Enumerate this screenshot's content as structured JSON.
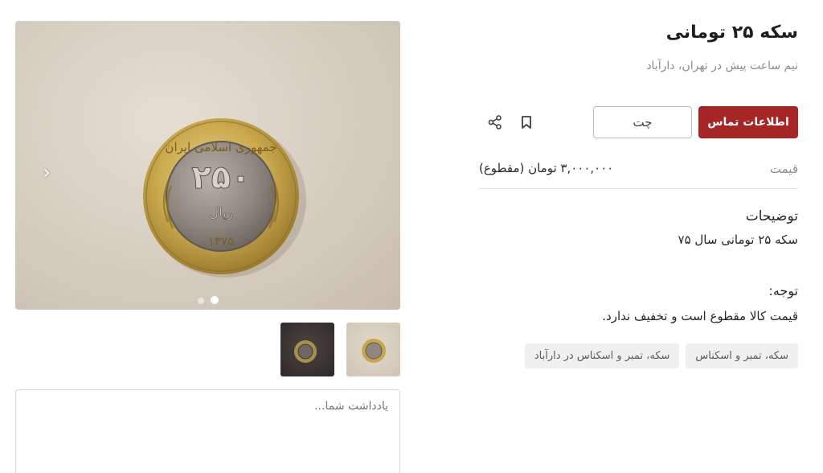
{
  "listing": {
    "title": "سکه ۲۵ تومانی",
    "subtitle": "نیم ساعت پیش در تهران، دارآباد"
  },
  "actions": {
    "contact_label": "اطلاعات تماس",
    "chat_label": "چت",
    "bookmark_icon": "bookmark-icon",
    "share_icon": "share-icon"
  },
  "price": {
    "label": "قیمت",
    "value": "۳,۰۰۰,۰۰۰ تومان (مقطوع)"
  },
  "description": {
    "heading": "توضیحات",
    "text": "سکه ۲۵ تومانی سال ۷۵"
  },
  "note": {
    "heading": "توجه:",
    "text": "قیمت کالا مقطوع است و تخفیف ندارد."
  },
  "tags": [
    "سکه، تمبر و اسکناس",
    "سکه، تمبر و اسکناس در دارآباد"
  ],
  "gallery": {
    "image_count": 2,
    "active_index": 1,
    "coin_face_text": "۲۵۰",
    "coin_unit_text": "ریال",
    "coin_ring_text": "جمهوری اسلامی ایران",
    "coin_year_text": "۱۳۷۵"
  },
  "notes_field": {
    "placeholder": "یادداشت شما..."
  },
  "colors": {
    "accent": "#a62626",
    "muted_text": "#8c8c8c",
    "tag_bg": "#f0f0f0"
  }
}
